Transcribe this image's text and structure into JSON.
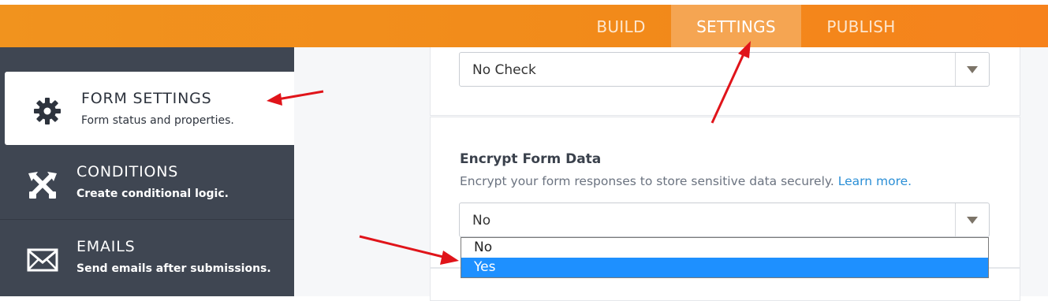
{
  "topnav": {
    "tabs": [
      {
        "label": "BUILD"
      },
      {
        "label": "SETTINGS"
      },
      {
        "label": "PUBLISH"
      }
    ]
  },
  "sidebar": {
    "items": [
      {
        "title": "FORM SETTINGS",
        "subtitle": "Form status and properties.",
        "icon": "gear-icon"
      },
      {
        "title": "CONDITIONS",
        "subtitle": "Create conditional logic.",
        "icon": "conditions-icon"
      },
      {
        "title": "EMAILS",
        "subtitle": "Send emails after submissions.",
        "icon": "envelope-icon"
      }
    ]
  },
  "main": {
    "first_select": {
      "value": "No Check"
    },
    "encrypt": {
      "heading": "Encrypt Form Data",
      "description": "Encrypt your form responses to store sensitive data securely.",
      "learn_more": "Learn more.",
      "select_value": "No",
      "options": [
        "No",
        "Yes"
      ],
      "highlighted_option": "Yes"
    }
  },
  "colors": {
    "topbar": "#f28a1a",
    "active_tab": "#f5a552",
    "sidebar": "#3f4652",
    "link": "#2b8fd6",
    "highlight": "#1e90ff",
    "annotation_arrow": "#e0141a"
  }
}
